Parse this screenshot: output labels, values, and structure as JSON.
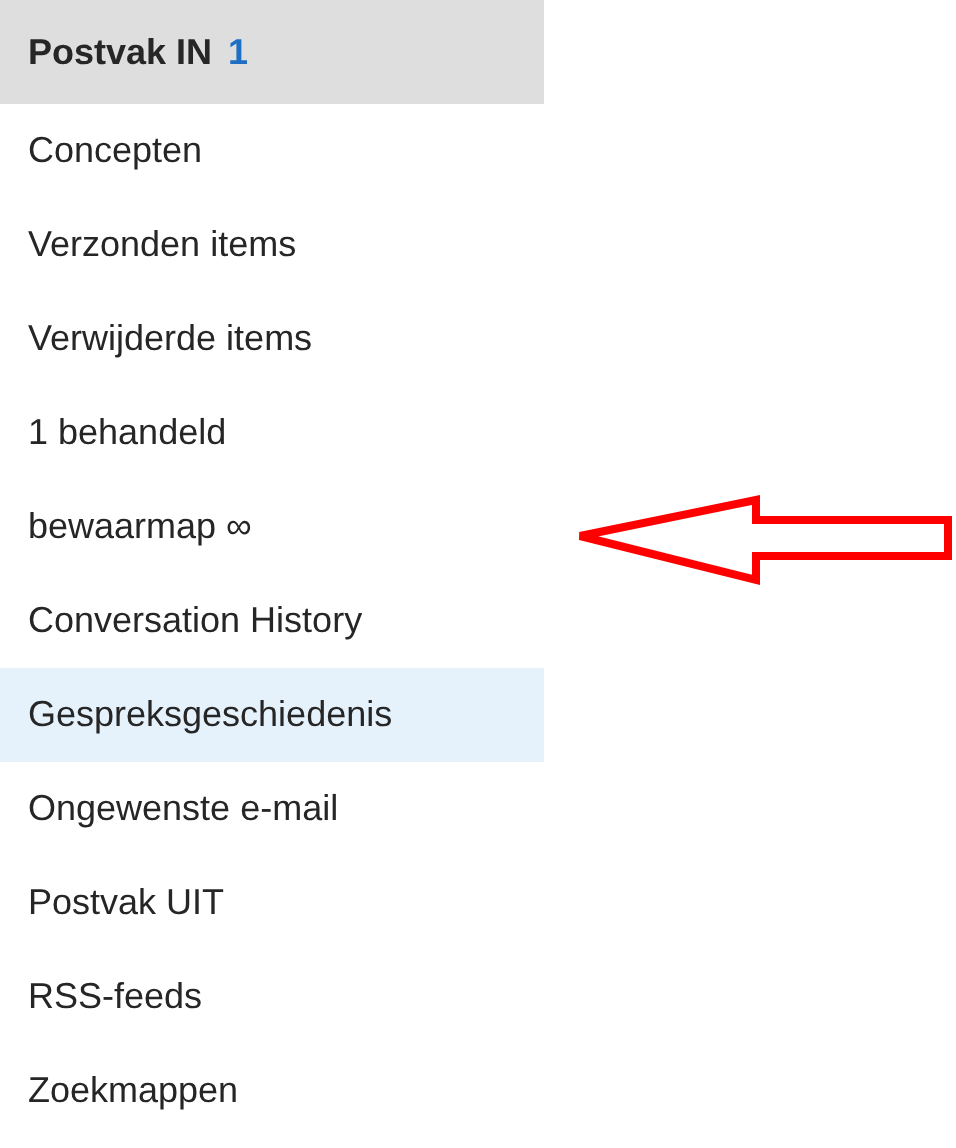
{
  "folders": [
    {
      "label": "Postvak IN",
      "count": "1",
      "selected": true,
      "hovered": false
    },
    {
      "label": "Concepten",
      "selected": false,
      "hovered": false
    },
    {
      "label": "Verzonden items",
      "selected": false,
      "hovered": false
    },
    {
      "label": "Verwijderde items",
      "selected": false,
      "hovered": false
    },
    {
      "label": "1 behandeld",
      "selected": false,
      "hovered": false
    },
    {
      "label": "bewaarmap ∞",
      "selected": false,
      "hovered": false
    },
    {
      "label": "Conversation History",
      "selected": false,
      "hovered": false
    },
    {
      "label": "Gespreksgeschiedenis",
      "selected": false,
      "hovered": true
    },
    {
      "label": "Ongewenste e-mail",
      "selected": false,
      "hovered": false
    },
    {
      "label": "Postvak UIT",
      "selected": false,
      "hovered": false
    },
    {
      "label": "RSS-feeds",
      "selected": false,
      "hovered": false
    },
    {
      "label": "Zoekmappen",
      "selected": false,
      "hovered": false
    }
  ]
}
